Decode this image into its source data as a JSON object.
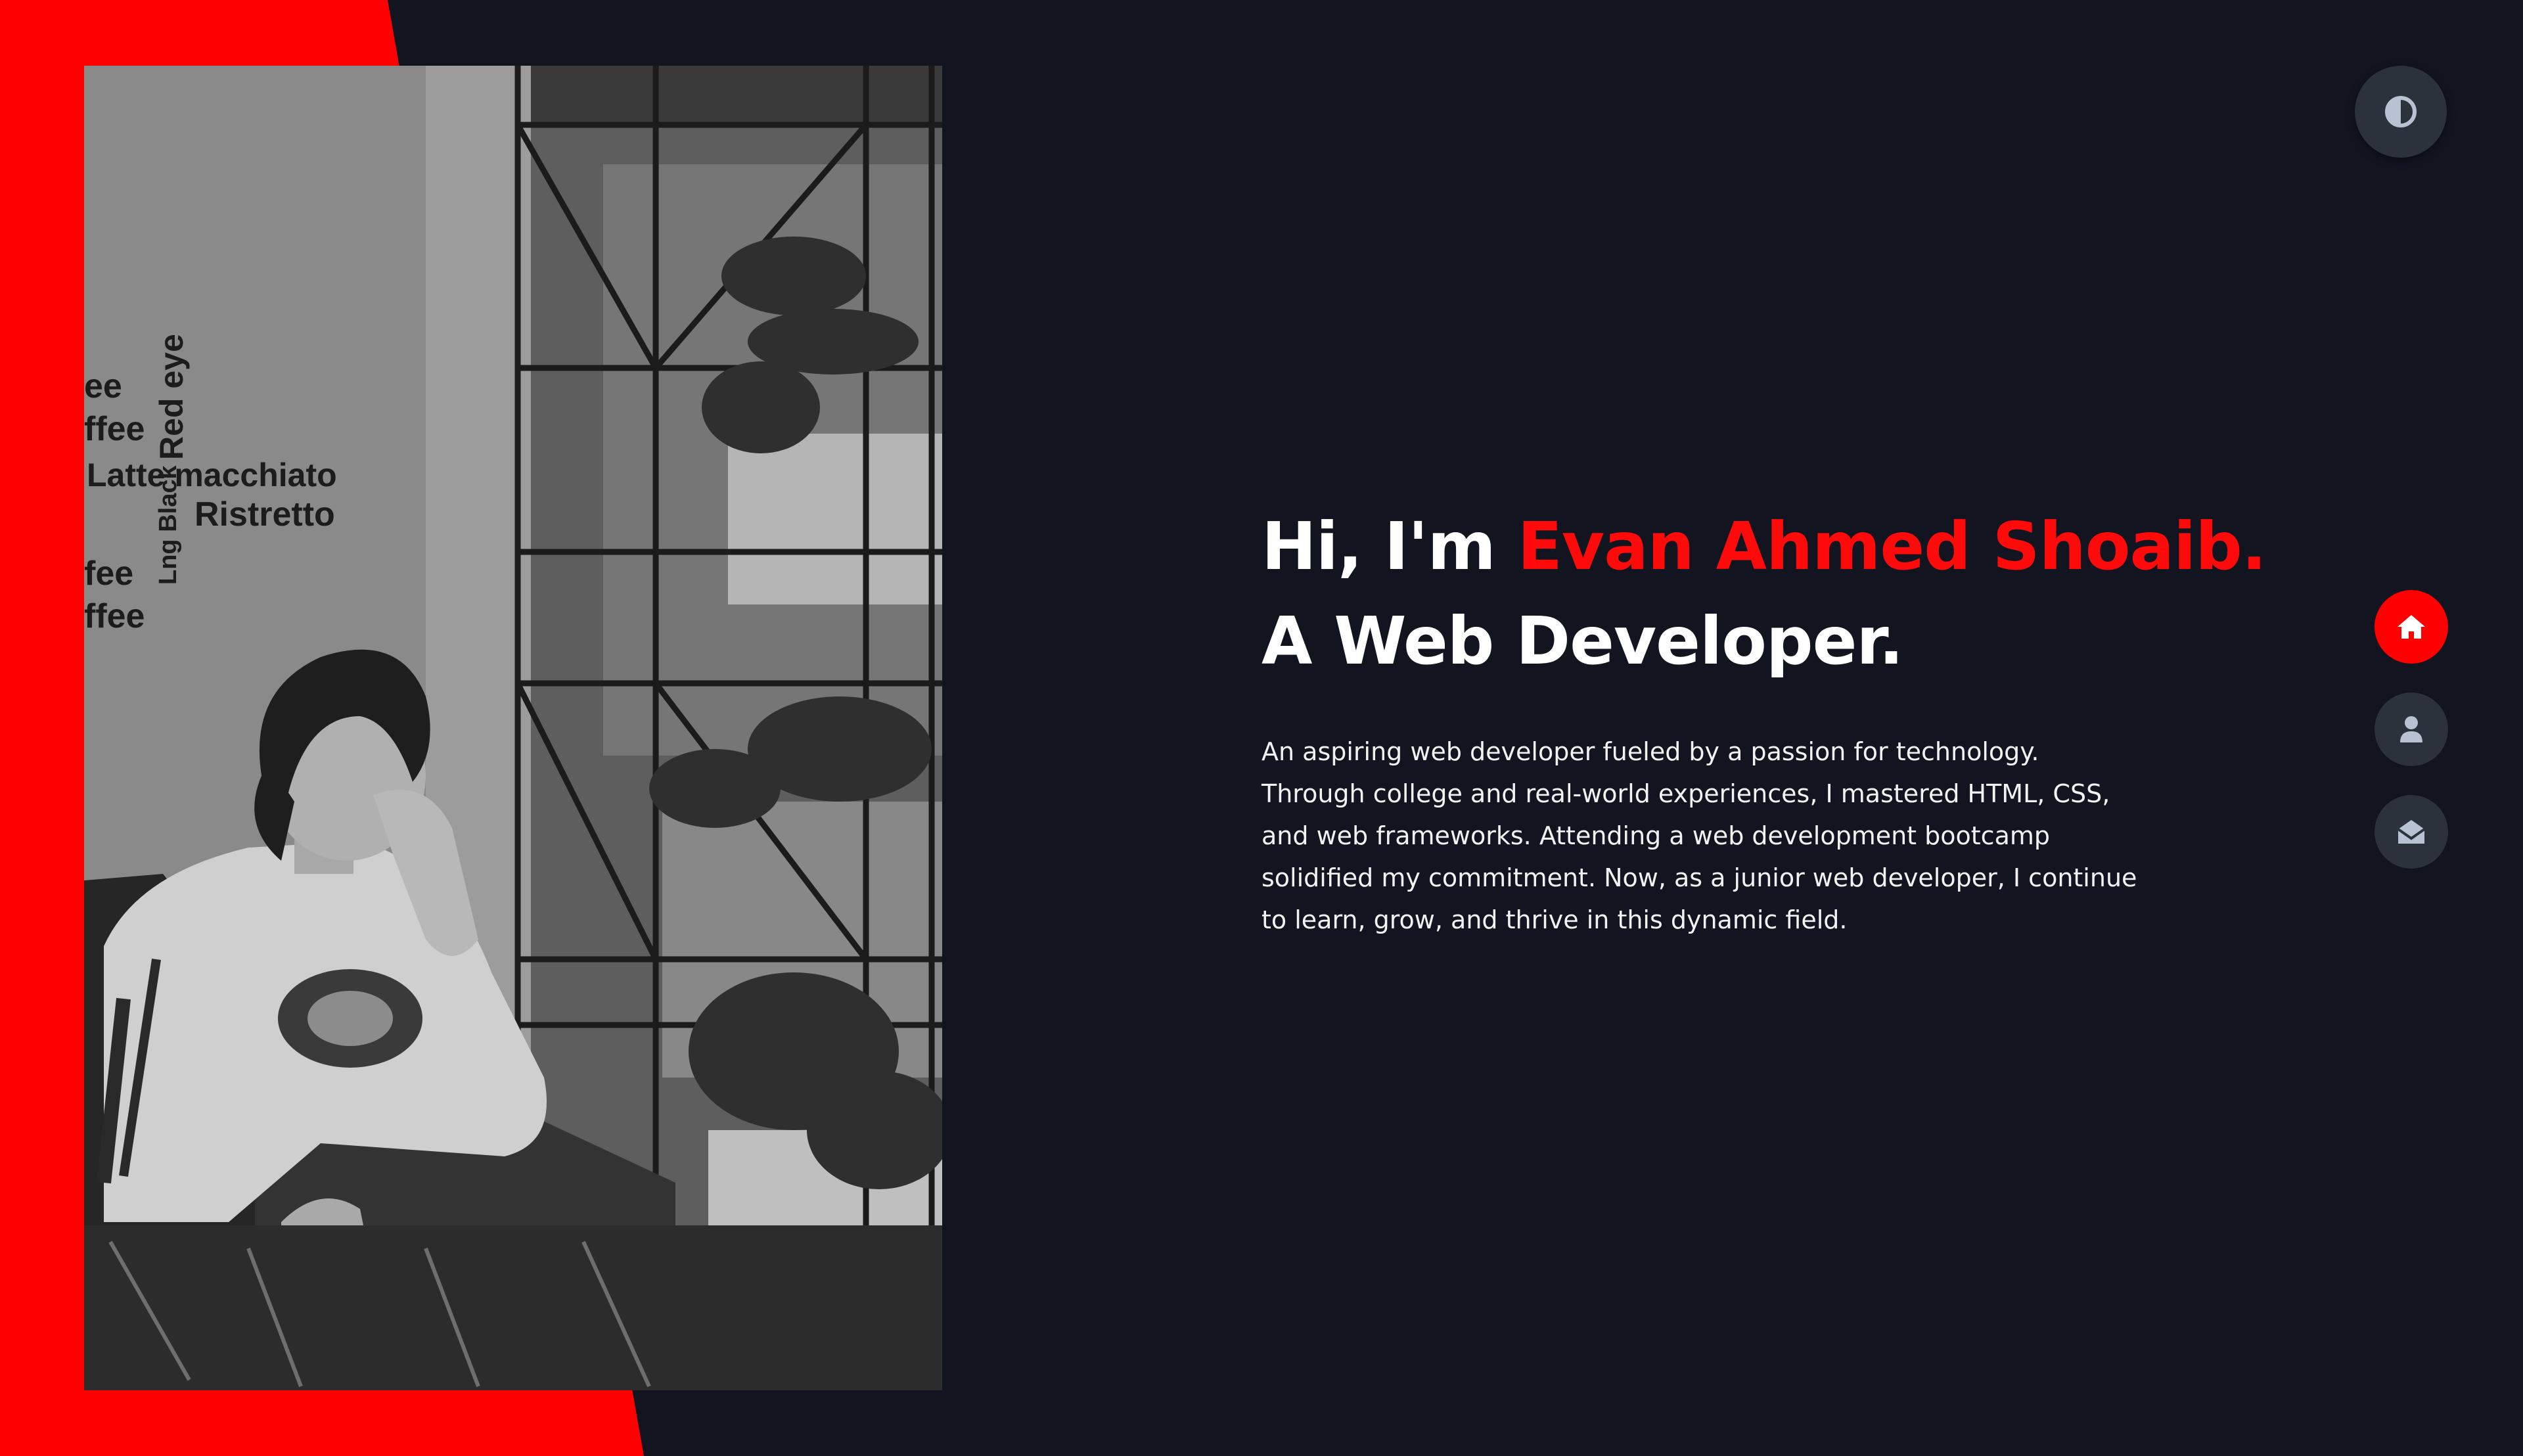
{
  "hero": {
    "greeting": "Hi, I'm ",
    "name": "Evan Ahmed Shoaib.",
    "role": "A Web Developer.",
    "bio": "An aspiring web developer fueled by a passion for technology. Through college and real-world experiences, I mastered HTML, CSS, and web frameworks. Attending a web development bootcamp solidified my commitment. Now, as a junior web developer, I continue to learn, grow, and thrive in this dynamic field."
  },
  "photo": {
    "wall_words": [
      "ee",
      "ffee",
      "Latte macchiato",
      "Ristretto",
      "Red eye",
      "Lng Black",
      "fee",
      "ffee"
    ]
  },
  "theme_toggle": {
    "icon": "half-circle-contrast-icon"
  },
  "side_nav": {
    "items": [
      {
        "icon": "home-icon",
        "active": true
      },
      {
        "icon": "user-icon",
        "active": false
      },
      {
        "icon": "envelope-open-icon",
        "active": false
      }
    ]
  },
  "colors": {
    "background": "#121520",
    "accent": "#ff0000",
    "button": "#2b323c",
    "icon": "#b9c2d3",
    "text": "#ffffff"
  }
}
